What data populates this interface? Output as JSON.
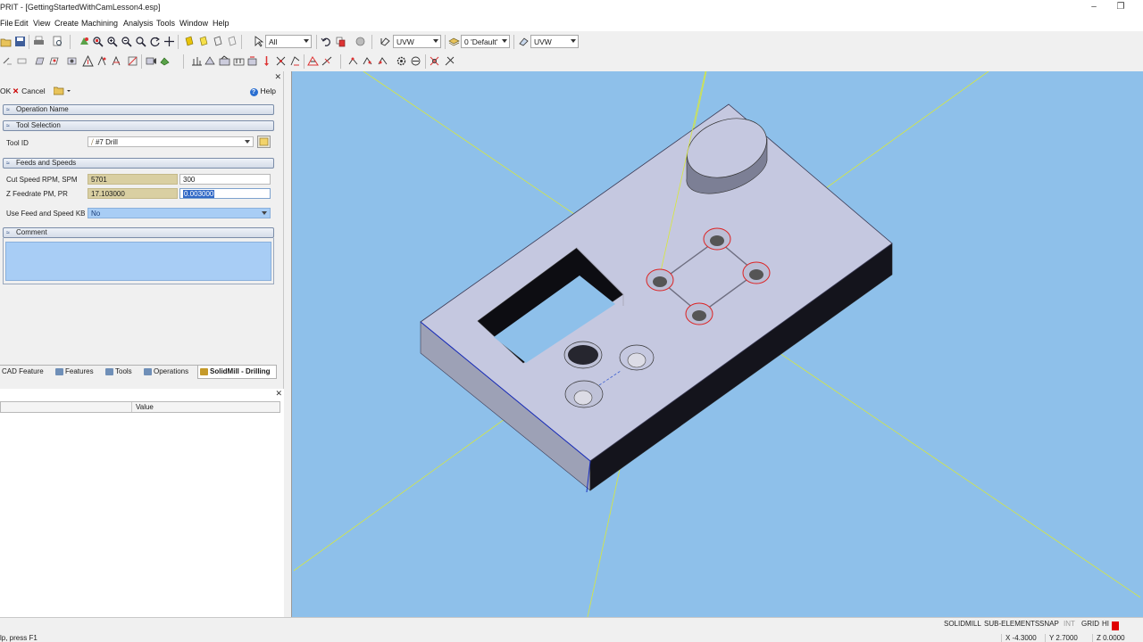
{
  "window": {
    "title": "PRIT - [GettingStartedWithCamLesson4.esp]",
    "minimize": "–",
    "restore": "❐"
  },
  "menu": [
    "File",
    "Edit",
    "View",
    "Create",
    "Machining",
    "Analysis",
    "Tools",
    "Window",
    "Help"
  ],
  "toolbar": {
    "filter_value": "All",
    "plane_value": "UVW",
    "layer_value": "0 'Default'",
    "work_plane_value": "UVW"
  },
  "dialog": {
    "ok_label": "OK",
    "cancel_label": "Cancel",
    "help_label": "Help",
    "sections": {
      "operation_name": "Operation Name",
      "tool_selection": "Tool Selection",
      "feeds_and_speeds": "Feeds and Speeds",
      "comment": "Comment"
    },
    "tool_id_label": "Tool ID",
    "tool_id_value": "#7 Drill",
    "cut_speed_label": "Cut Speed RPM, SPM",
    "cut_speed_rpm": "5701",
    "cut_speed_spm": "300",
    "z_feedrate_label": "Z Feedrate PM, PR",
    "z_feedrate_pm": "17.103000",
    "z_feedrate_pr": "0.003000",
    "use_feed_label": "Use Feed and Speed KB",
    "use_feed_value": "No"
  },
  "tabs": [
    "CAD Feature",
    "Features",
    "Tools",
    "Operations",
    "SolidMill - Drilling"
  ],
  "properties": {
    "value_header": "Value"
  },
  "status": {
    "flags": [
      "SOLIDMILL",
      "SUB-ELEMENTS",
      "SNAP",
      "INT",
      "GRID",
      "HI"
    ],
    "hint": "lp, press F1",
    "x": "X -4.3000",
    "y": "Y 2.7000",
    "z": "Z 0.0000"
  }
}
